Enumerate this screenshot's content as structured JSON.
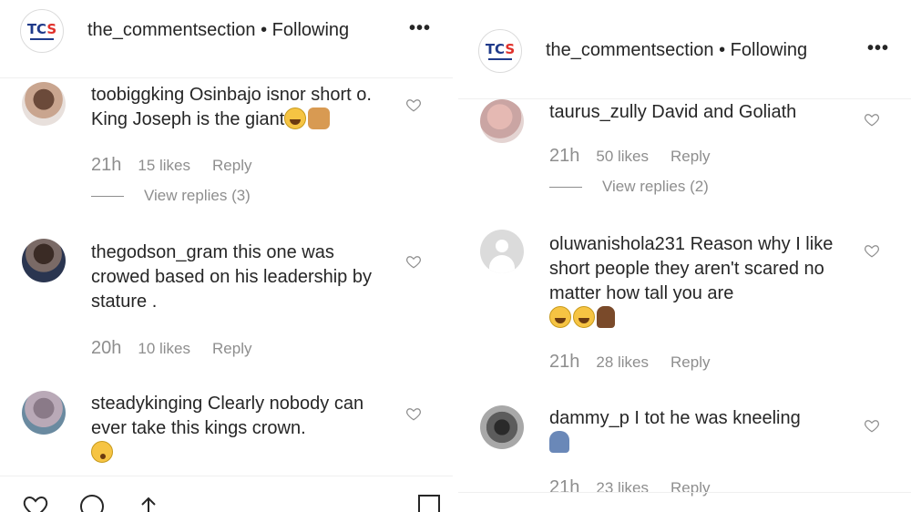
{
  "left_panel": {
    "account": "the_commentsection",
    "follow_status": "• Following",
    "more_label": "•••",
    "logo_text": "TCS",
    "comments": [
      {
        "username": "toobiggking",
        "text": " Osinbajo isnor short o. King Joseph is the giant",
        "emojis": [
          "laughing-emoji",
          "raised-hands-emoji"
        ],
        "time": "21h",
        "likes": "15 likes",
        "reply_label": "Reply",
        "view_replies": "View replies (3)"
      },
      {
        "username": "thegodson_gram",
        "text": " this one was crowed based on his leadership by stature .",
        "time": "20h",
        "likes": "10 likes",
        "reply_label": "Reply"
      },
      {
        "username": "steadykinging",
        "text": " Clearly nobody can ever take this kings crown.",
        "emojis": [
          "astonished-emoji"
        ]
      }
    ]
  },
  "right_panel": {
    "account": "the_commentsection",
    "follow_status": "• Following",
    "more_label": "•••",
    "logo_text": "TCS",
    "comments": [
      {
        "username": "taurus_zully",
        "text": " David and Goliath",
        "time": "21h",
        "likes": "50 likes",
        "reply_label": "Reply",
        "view_replies": "View replies (2)"
      },
      {
        "username": "oluwanishola231",
        "text": " Reason why I like short people they aren't scared no matter how tall you are",
        "emojis": [
          "laughing-emoji",
          "laughing-emoji",
          "running-person-emoji"
        ],
        "time": "21h",
        "likes": "28 likes",
        "reply_label": "Reply"
      },
      {
        "username": "dammy_p",
        "text": " I tot he was kneeling",
        "emojis": [
          "kneeling-person-emoji"
        ],
        "time": "21h",
        "likes": "23 likes",
        "reply_label": "Reply"
      }
    ]
  },
  "colors": {
    "text": "#262626",
    "meta": "#8e8e8e",
    "divider": "#efefef",
    "logo_blue": "#1f3a8a",
    "logo_red": "#e0302a"
  }
}
